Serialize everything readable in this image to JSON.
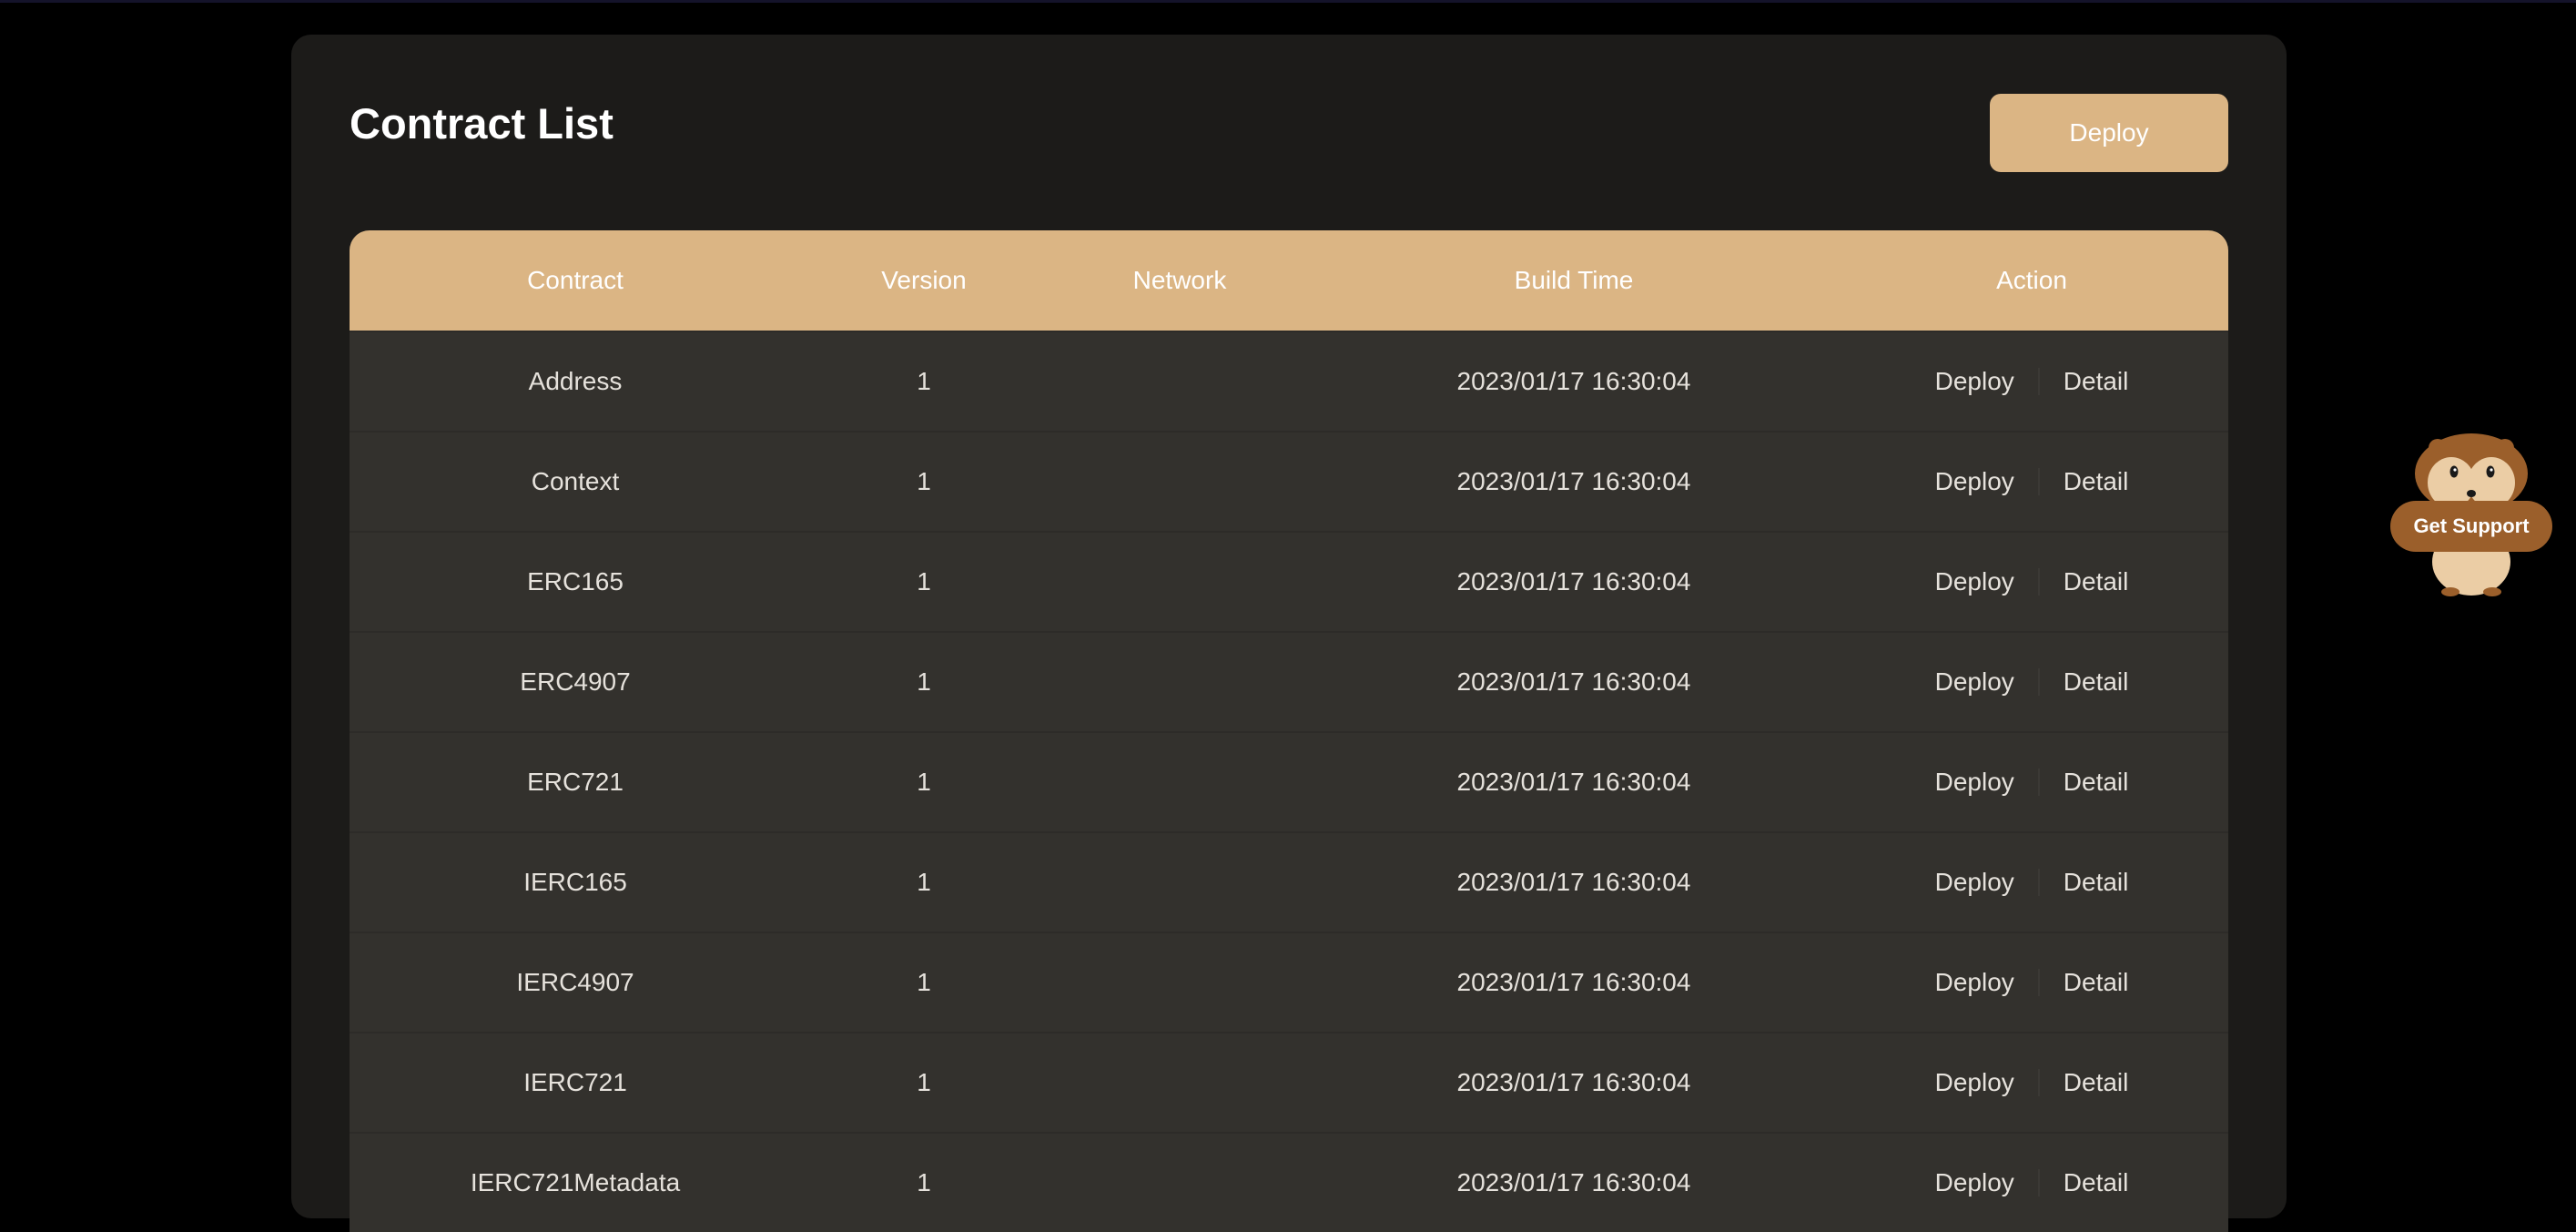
{
  "header": {
    "title": "Contract List",
    "deploy_label": "Deploy"
  },
  "table": {
    "columns": [
      "Contract",
      "Version",
      "Network",
      "Build Time",
      "Action"
    ],
    "rows": [
      {
        "contract": "Address",
        "version": "1",
        "network": "",
        "build_time": "2023/01/17 16:30:04",
        "deploy": "Deploy",
        "detail": "Detail"
      },
      {
        "contract": "Context",
        "version": "1",
        "network": "",
        "build_time": "2023/01/17 16:30:04",
        "deploy": "Deploy",
        "detail": "Detail"
      },
      {
        "contract": "ERC165",
        "version": "1",
        "network": "",
        "build_time": "2023/01/17 16:30:04",
        "deploy": "Deploy",
        "detail": "Detail"
      },
      {
        "contract": "ERC4907",
        "version": "1",
        "network": "",
        "build_time": "2023/01/17 16:30:04",
        "deploy": "Deploy",
        "detail": "Detail"
      },
      {
        "contract": "ERC721",
        "version": "1",
        "network": "",
        "build_time": "2023/01/17 16:30:04",
        "deploy": "Deploy",
        "detail": "Detail"
      },
      {
        "contract": "IERC165",
        "version": "1",
        "network": "",
        "build_time": "2023/01/17 16:30:04",
        "deploy": "Deploy",
        "detail": "Detail"
      },
      {
        "contract": "IERC4907",
        "version": "1",
        "network": "",
        "build_time": "2023/01/17 16:30:04",
        "deploy": "Deploy",
        "detail": "Detail"
      },
      {
        "contract": "IERC721",
        "version": "1",
        "network": "",
        "build_time": "2023/01/17 16:30:04",
        "deploy": "Deploy",
        "detail": "Detail"
      },
      {
        "contract": "IERC721Metadata",
        "version": "1",
        "network": "",
        "build_time": "2023/01/17 16:30:04",
        "deploy": "Deploy",
        "detail": "Detail"
      }
    ]
  },
  "support": {
    "label": "Get Support",
    "icon": "hamster-mascot-icon"
  },
  "colors": {
    "accent": "#dbb584",
    "panel": "#1c1b19",
    "row": "#33312d",
    "support": "#9b5f2b"
  }
}
